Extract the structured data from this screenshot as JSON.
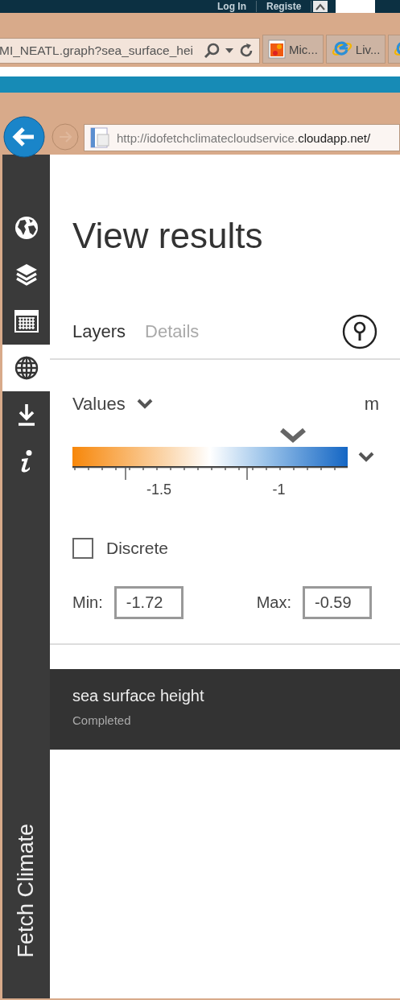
{
  "site_header": {
    "links": [
      "Log In",
      "Registe"
    ]
  },
  "browser": {
    "address": "MI_NEATL.graph?sea_surface_hei",
    "tabs": [
      {
        "kind": "page",
        "title": "Mic...",
        "selected": false
      },
      {
        "kind": "ie",
        "title": "Liv...",
        "selected": false
      },
      {
        "kind": "ie",
        "selected": false
      }
    ],
    "url_prefix": "http://idofetchclimatecloudservice.",
    "url_domain": "cloudapp.net/"
  },
  "sidebar": {
    "items": [
      {
        "kind": "earth",
        "selected": false
      },
      {
        "kind": "layers",
        "selected": false
      },
      {
        "kind": "calendar",
        "selected": false
      },
      {
        "kind": "globe",
        "selected": true
      },
      {
        "kind": "download",
        "selected": false
      },
      {
        "kind": "info",
        "selected": false
      }
    ],
    "app_name": "Fetch Climate"
  },
  "title": "View results",
  "tabs": [
    {
      "label": "Layers",
      "selected": true
    },
    {
      "label": "Details",
      "selected": false
    }
  ],
  "values": {
    "label": "Values",
    "unit": "m",
    "colorbar": {
      "level": 0.8
    },
    "tick_labels": [
      "-1.5",
      "-1"
    ],
    "discrete": {
      "label": "Discrete",
      "checked": false
    },
    "min": {
      "label": "Min:",
      "value": "-1.72"
    },
    "max": {
      "label": "Max:",
      "value": "-0.59"
    }
  },
  "result": {
    "name": "sea surface height",
    "status": "Completed"
  }
}
